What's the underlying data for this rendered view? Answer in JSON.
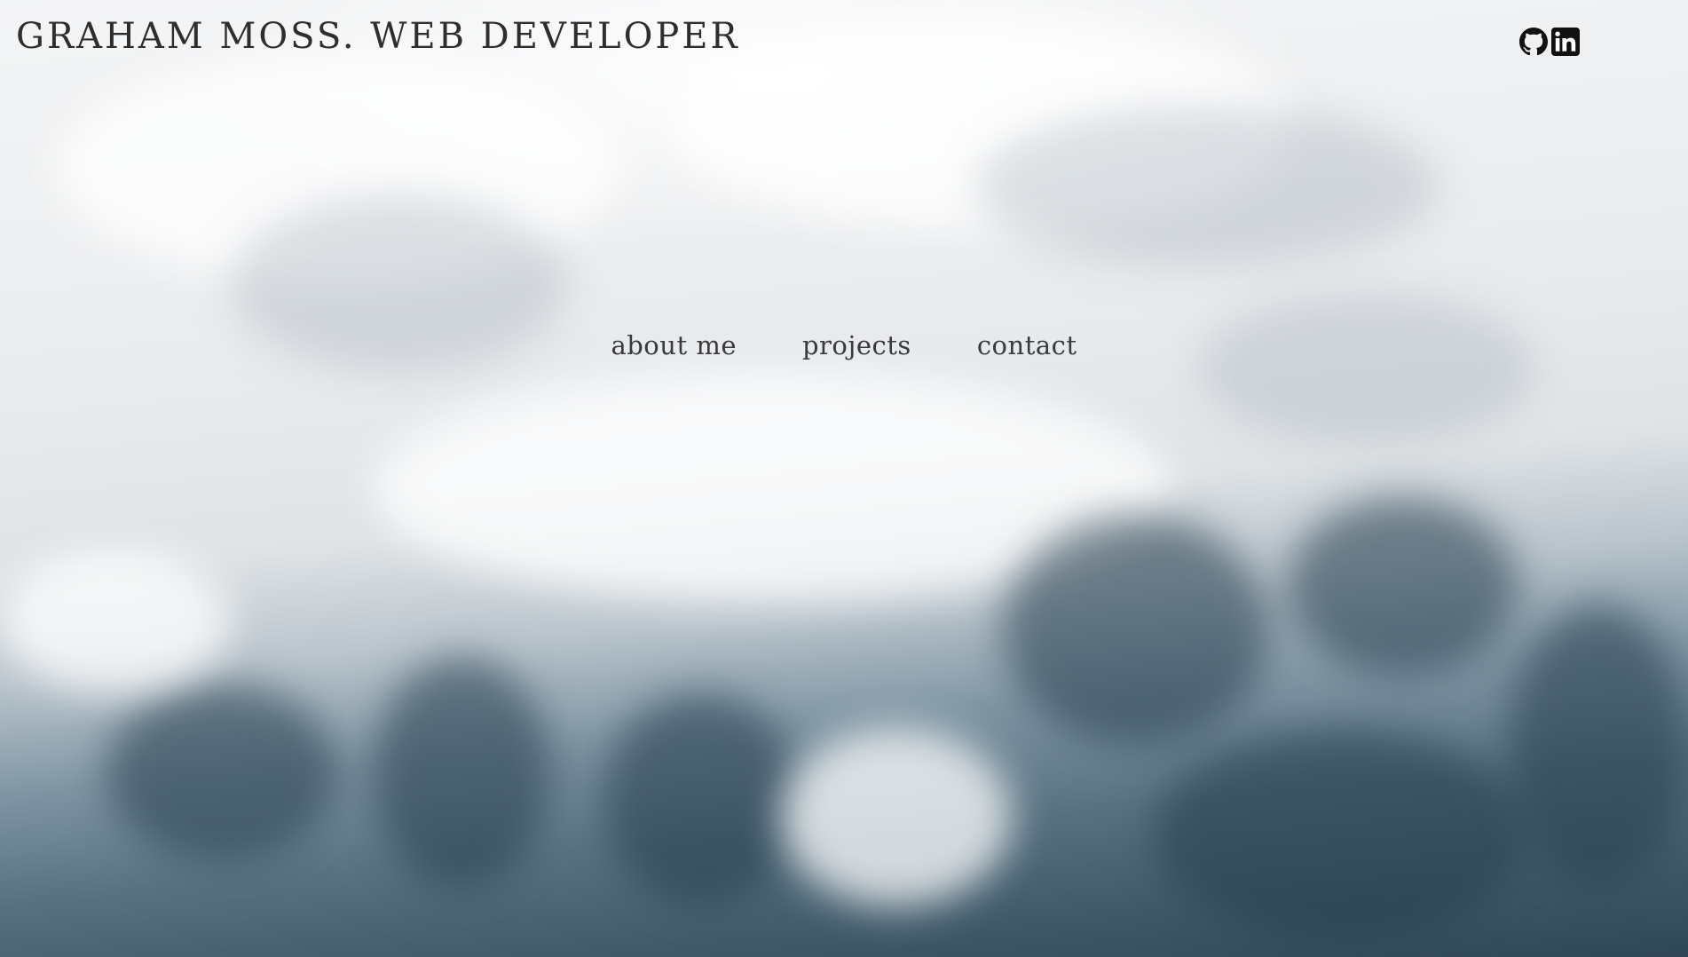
{
  "header": {
    "title": "GRAHAM MOSS. WEB DEVELOPER"
  },
  "social": [
    {
      "icon": "github-icon",
      "label": "GitHub"
    },
    {
      "icon": "linkedin-icon",
      "label": "LinkedIn"
    }
  ],
  "nav": {
    "about": "about me",
    "projects": "projects",
    "contact": "contact"
  },
  "colors": {
    "text": "#2e2e2e",
    "nav_text": "#3a3a3a",
    "sky_light": "#f4f5f6",
    "cloud_dark": "#2f4655"
  }
}
